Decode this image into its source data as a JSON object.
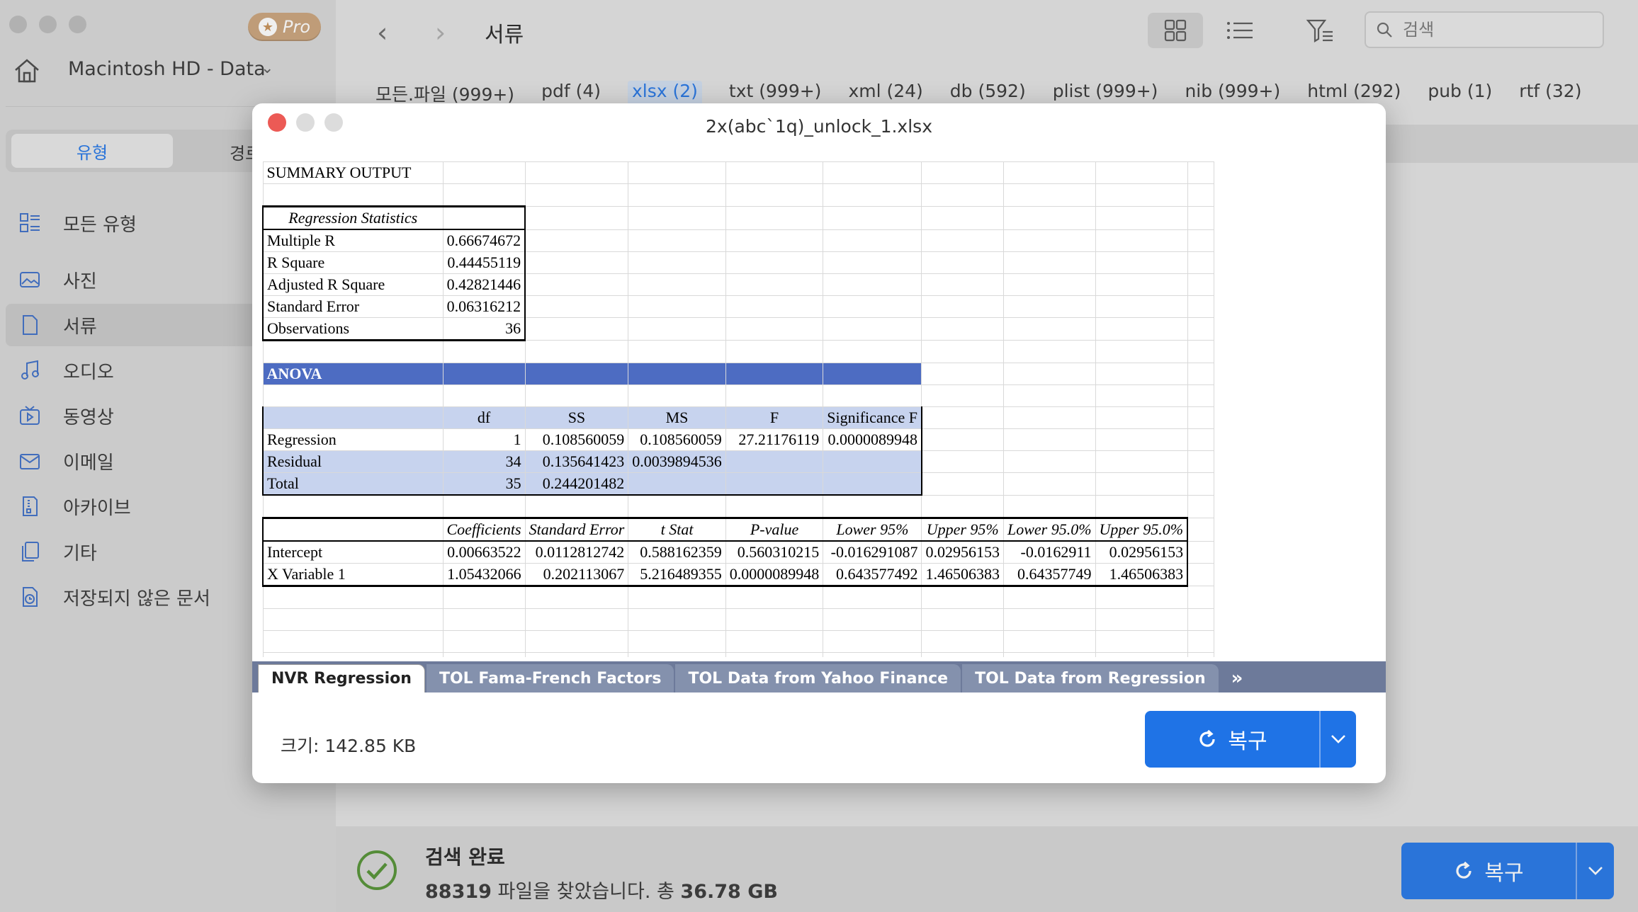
{
  "sidebar": {
    "pro_label": "Pro",
    "drive": "Macintosh HD - Data",
    "segments": {
      "type": "유형",
      "path": "경로"
    },
    "categories": [
      {
        "label": "모든 유형",
        "icon": "all-types-icon"
      },
      {
        "label": "사진",
        "icon": "photo-icon"
      },
      {
        "label": "서류",
        "icon": "document-icon"
      },
      {
        "label": "오디오",
        "icon": "audio-icon"
      },
      {
        "label": "동영상",
        "icon": "video-icon"
      },
      {
        "label": "이메일",
        "icon": "email-icon"
      },
      {
        "label": "아카이브",
        "icon": "archive-icon"
      },
      {
        "label": "기타",
        "icon": "other-icon"
      },
      {
        "label": "저장되지 않은 문서",
        "icon": "unsaved-doc-icon"
      }
    ]
  },
  "toolbar": {
    "title": "서류",
    "search_placeholder": "검색"
  },
  "ext_tabs": [
    "모든.파일 (999+)",
    "pdf (4)",
    "xlsx (2)",
    "txt (999+)",
    "xml (24)",
    "db (592)",
    "plist (999+)",
    "nib (999+)",
    "html (292)",
    "pub (1)",
    "rtf (32)"
  ],
  "status": {
    "title": "검색 완료",
    "count": "88319",
    "middle": " 파일을 찾았습니다. 총 ",
    "total": "36.78 GB",
    "recover": "복구"
  },
  "modal": {
    "title": "2x(abc`1q)_unlock_1.xlsx",
    "size_label": "크기: 142.85 KB",
    "recover": "복구",
    "sheet_tabs": [
      "NVR Regression",
      "TOL Fama-French Factors",
      "TOL Data from Yahoo Finance",
      "TOL Data from Regression"
    ]
  },
  "sheet": {
    "summary": "SUMMARY OUTPUT",
    "reg_stats_title": "Regression Statistics",
    "reg_stats": [
      [
        "Multiple R",
        "0.66674672"
      ],
      [
        "R Square",
        "0.44455119"
      ],
      [
        "Adjusted R Square",
        "0.42821446"
      ],
      [
        "Standard Error",
        "0.06316212"
      ],
      [
        "Observations",
        "36"
      ]
    ],
    "anova_title": "ANOVA",
    "anova_headers": [
      "df",
      "SS",
      "MS",
      "F",
      "Significance F"
    ],
    "anova_rows": [
      [
        "Regression",
        "1",
        "0.108560059",
        "0.108560059",
        "27.21176119",
        "0.0000089948"
      ],
      [
        "Residual",
        "34",
        "0.135641423",
        "0.0039894536",
        "",
        ""
      ],
      [
        "Total",
        "35",
        "0.244201482",
        "",
        "",
        ""
      ]
    ],
    "coef_headers": [
      "Coefficients",
      "Standard Error",
      "t Stat",
      "P-value",
      "Lower 95%",
      "Upper 95%",
      "Lower 95.0%",
      "Upper 95.0%"
    ],
    "coef_rows": [
      [
        "Intercept",
        "0.00663522",
        "0.0112812742",
        "0.588162359",
        "0.560310215",
        "-0.016291087",
        "0.02956153",
        "-0.0162911",
        "0.02956153"
      ],
      [
        "X Variable 1",
        "1.05432066",
        "0.202113067",
        "5.216489355",
        "0.0000089948",
        "0.643577492",
        "1.46506383",
        "0.64357749",
        "1.46506383"
      ]
    ]
  }
}
